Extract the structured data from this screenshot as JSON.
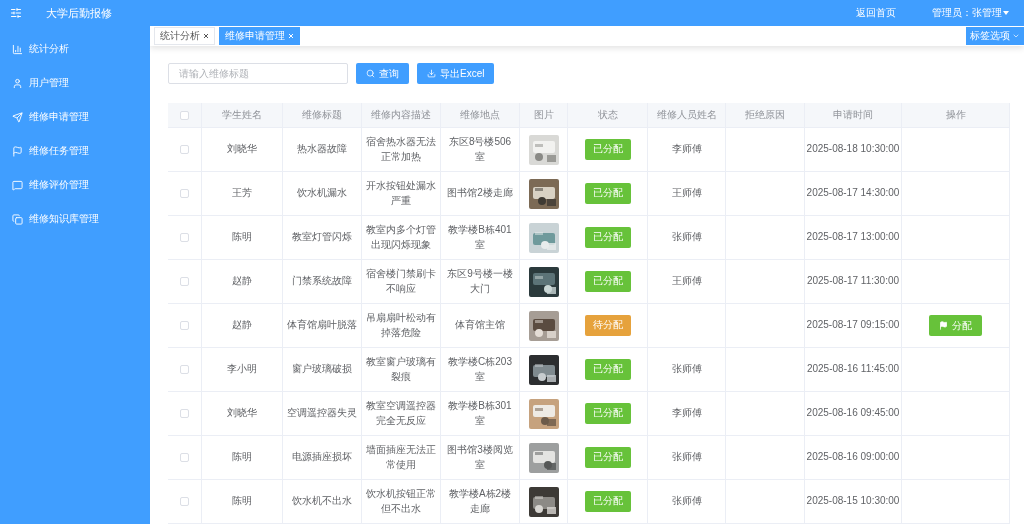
{
  "header": {
    "title": "大学后勤报修",
    "home_link": "返回首页",
    "user": "管理员：张管理"
  },
  "sidebar": {
    "items": [
      "统计分析",
      "用户管理",
      "维修申请管理",
      "维修任务管理",
      "维修评价管理",
      "维修知识库管理"
    ]
  },
  "tabs": [
    {
      "label": "统计分析",
      "selected": false
    },
    {
      "label": "维修申请管理",
      "selected": true
    }
  ],
  "tab_options": "标签选项",
  "search": {
    "placeholder": "请输入维修标题"
  },
  "buttons": [
    "查询",
    "导出Excel"
  ],
  "table": {
    "columns": [
      "学生姓名",
      "维修标题",
      "维修内容描述",
      "维修地点",
      "图片",
      "状态",
      "维修人员姓名",
      "拒绝原因",
      "申请时间",
      "操作"
    ],
    "header_checked": false,
    "rows": [
      {
        "checked": false,
        "student": "刘晓华",
        "title": "热水器故障",
        "description": "宿舍热水器无法正常加热",
        "location": "东区8号楼506室",
        "status": {
          "label": "已分配",
          "kind": "assigned"
        },
        "worker": "李师傅",
        "time": "2025-08-18 10:30:00"
      },
      {
        "checked": false,
        "student": "王芳",
        "title": "饮水机漏水",
        "description": "开水按钮处漏水严重",
        "location": "图书馆2楼走廊",
        "status": {
          "label": "已分配",
          "kind": "assigned"
        },
        "worker": "王师傅",
        "time": "2025-08-17 14:30:00"
      },
      {
        "checked": false,
        "student": "陈明",
        "title": "教室灯管闪烁",
        "description": "教室内多个灯管出现闪烁现象",
        "location": "教学楼B栋401室",
        "status": {
          "label": "已分配",
          "kind": "assigned"
        },
        "worker": "张师傅",
        "time": "2025-08-17 13:00:00"
      },
      {
        "checked": false,
        "student": "赵静",
        "title": "门禁系统故障",
        "description": "宿舍楼门禁刷卡不响应",
        "location": "东区9号楼一楼大门",
        "status": {
          "label": "已分配",
          "kind": "assigned"
        },
        "worker": "王师傅",
        "time": "2025-08-17 11:30:00"
      },
      {
        "checked": false,
        "student": "赵静",
        "title": "体育馆扇叶脱落",
        "description": "吊扇扇叶松动有掉落危险",
        "location": "体育馆主馆",
        "status": {
          "label": "待分配",
          "kind": "pending"
        },
        "time": "2025-08-17 09:15:00",
        "action": "分配"
      },
      {
        "checked": false,
        "student": "李小明",
        "title": "窗户玻璃破损",
        "description": "教室窗户玻璃有裂痕",
        "location": "教学楼C栋203室",
        "status": {
          "label": "已分配",
          "kind": "assigned"
        },
        "worker": "张师傅",
        "time": "2025-08-16 11:45:00"
      },
      {
        "checked": false,
        "student": "刘晓华",
        "title": "空调遥控器失灵",
        "description": "教室空调遥控器完全无反应",
        "location": "教学楼B栋301室",
        "status": {
          "label": "已分配",
          "kind": "assigned"
        },
        "worker": "李师傅",
        "time": "2025-08-16 09:45:00"
      },
      {
        "checked": false,
        "student": "陈明",
        "title": "电源插座损坏",
        "description": "墙面插座无法正常使用",
        "location": "图书馆3楼阅览室",
        "status": {
          "label": "已分配",
          "kind": "assigned"
        },
        "worker": "张师傅",
        "time": "2025-08-16 09:00:00"
      },
      {
        "checked": false,
        "student": "陈明",
        "title": "饮水机不出水",
        "description": "饮水机按钮正常但不出水",
        "location": "教学楼A栋2楼走廊",
        "status": {
          "label": "已分配",
          "kind": "assigned"
        },
        "worker": "张师傅",
        "time": "2025-08-15 10:30:00"
      }
    ]
  }
}
